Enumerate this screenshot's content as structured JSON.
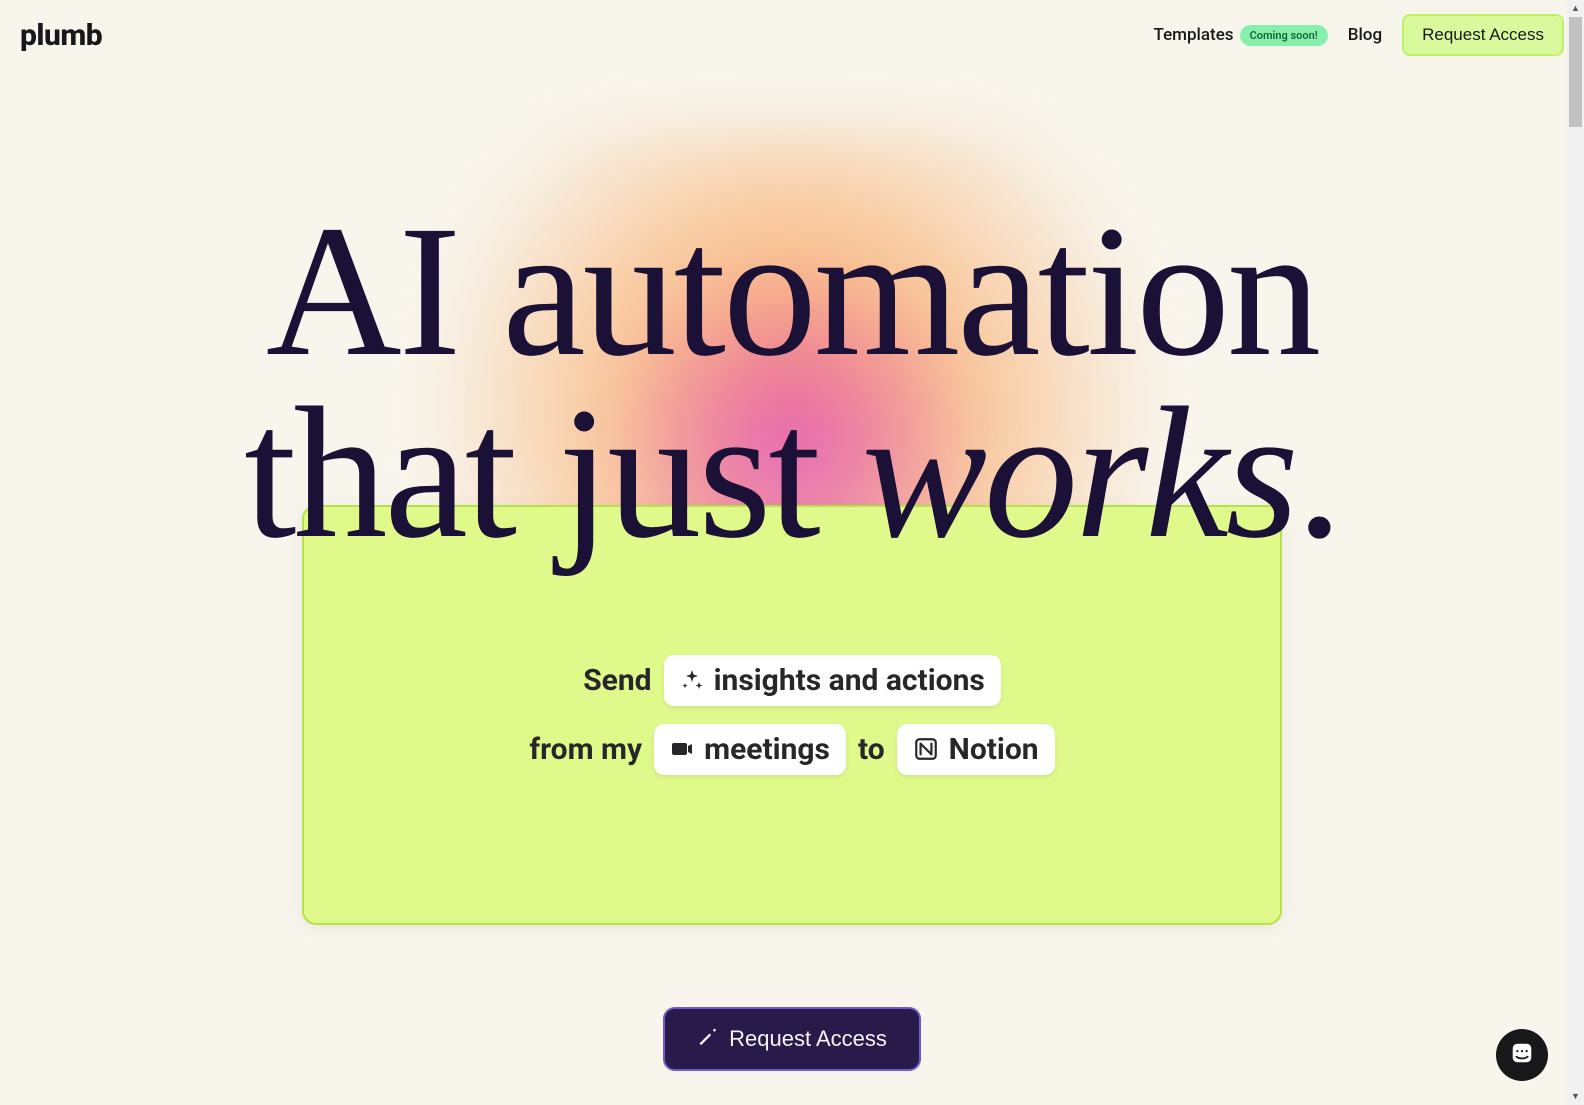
{
  "brand": {
    "name": "plumb"
  },
  "nav": {
    "templates_label": "Templates",
    "templates_badge": "Coming soon!",
    "blog_label": "Blog",
    "request_access_label": "Request Access"
  },
  "hero": {
    "headline_line1": "AI automation",
    "headline_line2_part1": "that just ",
    "headline_line2_em": "works",
    "headline_line2_part2": "."
  },
  "card": {
    "line1": {
      "word1": "Send",
      "chip1": "insights and actions"
    },
    "line2": {
      "word1": "from my",
      "chip1": "meetings",
      "word2": "to",
      "chip2": "Notion"
    },
    "chip1_icon": "sparkles-icon",
    "chip2_icon": "video-icon",
    "chip3_icon": "notion-icon"
  },
  "cta": {
    "label": "Request Access",
    "icon": "wand-icon"
  },
  "intercom": {
    "icon": "intercom-icon"
  },
  "colors": {
    "bg": "#f8f5ec",
    "lime_card": "#dff98b",
    "lime_border": "#b5e24a",
    "lime_btn": "#d9f99d",
    "green_badge": "#86efac",
    "cta_bg": "#281a4a",
    "cta_border": "#6d5bcf"
  }
}
